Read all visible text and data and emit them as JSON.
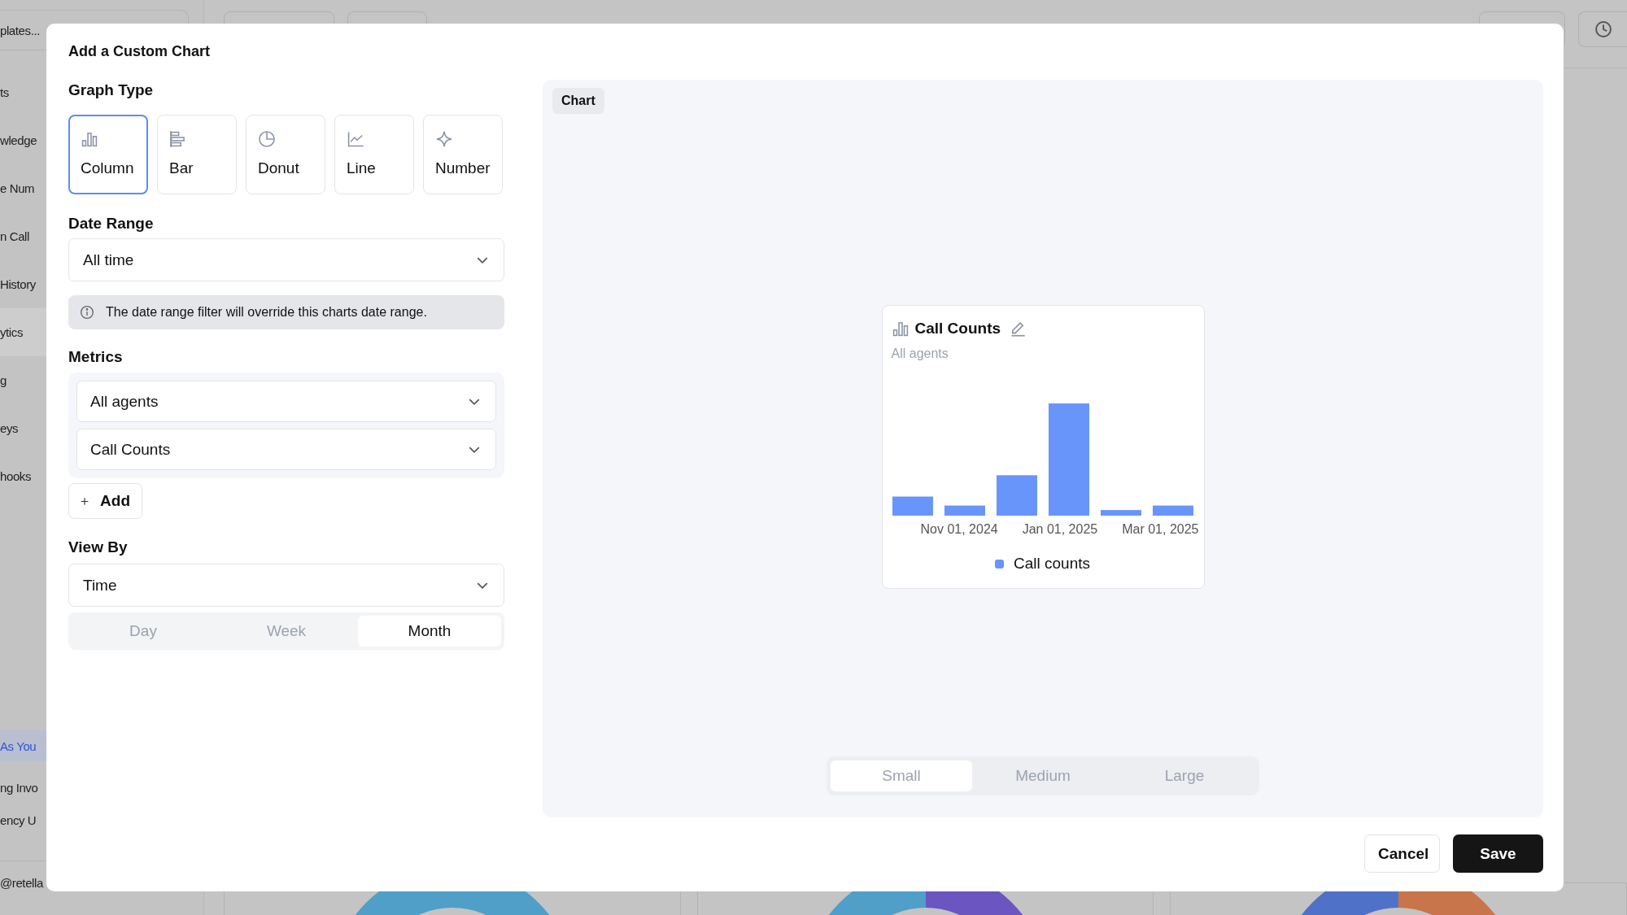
{
  "background": {
    "sidebar_items": [
      {
        "label": "plates...",
        "kind": "card"
      },
      {
        "label": "ts",
        "kind": "item"
      },
      {
        "label": "wledge",
        "kind": "item"
      },
      {
        "label": "e Num",
        "kind": "item"
      },
      {
        "label": "n Call",
        "kind": "item"
      },
      {
        "label": "History",
        "kind": "item"
      },
      {
        "label": "ytics",
        "kind": "active"
      },
      {
        "label": "g",
        "kind": "item"
      },
      {
        "label": "eys",
        "kind": "item"
      },
      {
        "label": "hooks",
        "kind": "item"
      },
      {
        "label": "As You",
        "kind": "link"
      },
      {
        "label": "ng Invo",
        "kind": "item"
      },
      {
        "label": "ency U",
        "kind": "item"
      },
      {
        "label": "@retella",
        "kind": "account"
      }
    ]
  },
  "dialog": {
    "title": "Add a Custom Chart",
    "graph_type": {
      "label": "Graph Type",
      "options": [
        {
          "label": "Column",
          "kind": "column",
          "selected": true
        },
        {
          "label": "Bar",
          "kind": "bar",
          "selected": false
        },
        {
          "label": "Donut",
          "kind": "donut",
          "selected": false
        },
        {
          "label": "Line",
          "kind": "line",
          "selected": false
        },
        {
          "label": "Number",
          "kind": "number",
          "selected": false
        }
      ]
    },
    "date_range": {
      "label": "Date Range",
      "value": "All time",
      "note": "The date range filter will override this charts date range."
    },
    "metrics": {
      "label": "Metrics",
      "selects": [
        {
          "value": "All agents"
        },
        {
          "value": "Call Counts"
        }
      ],
      "add_button": "Add"
    },
    "view_by": {
      "label": "View By",
      "value": "Time",
      "granularity": [
        {
          "label": "Day",
          "selected": false
        },
        {
          "label": "Week",
          "selected": false
        },
        {
          "label": "Month",
          "selected": true
        }
      ]
    },
    "preview": {
      "tag": "Chart",
      "card": {
        "title": "Call Counts",
        "subtitle": "All agents",
        "x_labels": [
          "Nov 01, 2024",
          "Jan 01, 2025",
          "Mar 01, 2025"
        ],
        "legend": "Call counts",
        "color": "#6895fa"
      },
      "sizes": [
        {
          "label": "Small",
          "selected": true
        },
        {
          "label": "Medium",
          "selected": false
        },
        {
          "label": "Large",
          "selected": false
        }
      ]
    },
    "buttons": [
      {
        "label": "Cancel",
        "kind": "secondary"
      },
      {
        "label": "Save",
        "kind": "primary"
      }
    ]
  }
}
